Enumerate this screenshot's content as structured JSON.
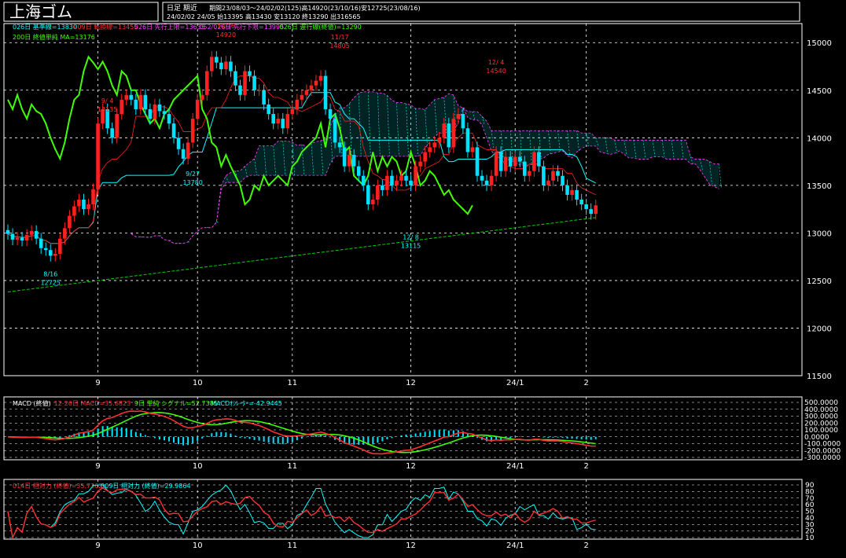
{
  "header": {
    "title": "上海ゴム",
    "period_type": "日足 期近",
    "info_line1": "期間23/08/03～24/02/02(125)高14920(23/10/16)安12725(23/08/16)",
    "info_line2": "24/02/02 24/05 始13395 高13430 安13120 終13290 出316565"
  },
  "colors": {
    "up_candle": "#ff2020",
    "down_candle": "#00e0ff",
    "grid": "#ffffff",
    "cloud": "#ff40ff",
    "cloud_hatch": "#00ffff",
    "ma200": "#00d000",
    "lagging": "#40ff00",
    "base_line": "#00ffff",
    "conversion_line": "#ff2020"
  },
  "legend": {
    "line1": [
      {
        "text": "026日 基準線=13830",
        "color": "#00ffff"
      },
      {
        "text": "009日 転換線=13455",
        "color": "#ff3030"
      },
      {
        "text": "026日 先行上限=13635",
        "color": "#ff40ff"
      },
      {
        "text": "052/026日 先行下限=13995",
        "color": "#ff40ff"
      },
      {
        "text": "026日 遅行線(終値)=13290",
        "color": "#40ff00"
      }
    ],
    "line2": [
      {
        "text": "200日 終値単純 MA=13176",
        "color": "#40ff00"
      }
    ]
  },
  "macd_legend": [
    {
      "text": "MACD (終値)",
      "color": "#ffffff"
    },
    {
      "text": "12-26日 MACD=35.6823",
      "color": "#ff3030"
    },
    {
      "text": "9日 単純 シグナル=52.7385",
      "color": "#40ff00"
    },
    {
      "text": "MACDｵｼﾚｰﾀｰ=-42.9445",
      "color": "#00ffff"
    }
  ],
  "rsi_legend": [
    {
      "text": "014日 相対力 (終値)=35.7362",
      "color": "#ff3030"
    },
    {
      "text": "009日 相対力 (終値)=29.9864",
      "color": "#00ffff"
    }
  ],
  "chart_data": {
    "type": "candlestick",
    "dates": [
      "23/08/03",
      "23/08/04",
      "23/08/07",
      "23/08/08",
      "23/08/09",
      "23/08/10",
      "23/08/11",
      "23/08/14",
      "23/08/15",
      "23/08/16",
      "23/08/17",
      "23/08/18",
      "23/08/21",
      "23/08/22",
      "23/08/23",
      "23/08/24",
      "23/08/25",
      "23/08/28",
      "23/08/29",
      "23/08/30",
      "23/08/31",
      "23/09/01",
      "23/09/04",
      "23/09/05",
      "23/09/06",
      "23/09/07",
      "23/09/08",
      "23/09/11",
      "23/09/12",
      "23/09/13",
      "23/09/14",
      "23/09/15",
      "23/09/18",
      "23/09/19",
      "23/09/20",
      "23/09/21",
      "23/09/22",
      "23/09/25",
      "23/09/26",
      "23/09/27",
      "23/09/28",
      "23/10/09",
      "23/10/10",
      "23/10/11",
      "23/10/12",
      "23/10/13",
      "23/10/16",
      "23/10/17",
      "23/10/18",
      "23/10/19",
      "23/10/20",
      "23/10/23",
      "23/10/24",
      "23/10/25",
      "23/10/26",
      "23/10/27",
      "23/10/30",
      "23/10/31",
      "23/11/01",
      "23/11/02",
      "23/11/03",
      "23/11/06",
      "23/11/07",
      "23/11/08",
      "23/11/09",
      "23/11/10",
      "23/11/13",
      "23/11/14",
      "23/11/15",
      "23/11/16",
      "23/11/17",
      "23/11/20",
      "23/11/21",
      "23/11/22",
      "23/11/23",
      "23/11/24",
      "23/11/27",
      "23/11/28",
      "23/11/29",
      "23/11/30",
      "23/12/01",
      "23/12/04",
      "23/12/05",
      "23/12/06",
      "23/12/07",
      "23/12/08",
      "23/12/11",
      "23/12/12",
      "23/12/13",
      "23/12/14",
      "23/12/15",
      "23/12/18",
      "23/12/19",
      "23/12/20",
      "23/12/21",
      "23/12/22",
      "23/12/25",
      "23/12/26",
      "23/12/27",
      "23/12/28",
      "23/12/29",
      "24/01/02",
      "24/01/03",
      "24/01/04",
      "24/01/05",
      "24/01/08",
      "24/01/09",
      "24/01/10",
      "24/01/11",
      "24/01/12",
      "24/01/15",
      "24/01/16",
      "24/01/17",
      "24/01/18",
      "24/01/19",
      "24/01/22",
      "24/01/23",
      "24/01/24",
      "24/01/25",
      "24/01/26",
      "24/01/29",
      "24/01/30",
      "24/01/31",
      "24/02/01",
      "24/02/02"
    ],
    "close": [
      12990,
      12930,
      12950,
      12920,
      12980,
      13020,
      12940,
      12840,
      12820,
      12760,
      12780,
      12940,
      13050,
      13180,
      13280,
      13350,
      13250,
      13300,
      13460,
      14150,
      14300,
      14100,
      14000,
      14250,
      14400,
      14450,
      14400,
      14300,
      14450,
      14300,
      14200,
      14350,
      14280,
      14250,
      14150,
      14000,
      13880,
      13780,
      13950,
      14200,
      14400,
      14450,
      14700,
      14850,
      14790,
      14720,
      14800,
      14700,
      14550,
      14450,
      14700,
      14650,
      14500,
      14500,
      14350,
      14250,
      14150,
      14200,
      14100,
      14250,
      14300,
      14400,
      14450,
      14500,
      14550,
      14600,
      14650,
      14300,
      14200,
      13950,
      13900,
      13700,
      13820,
      13700,
      13600,
      13500,
      13300,
      13350,
      13500,
      13450,
      13600,
      13500,
      13550,
      13600,
      13550,
      13500,
      13700,
      13750,
      13850,
      13900,
      13950,
      14000,
      14150,
      13900,
      14200,
      14250,
      14100,
      13850,
      13900,
      13600,
      13550,
      13500,
      13600,
      13850,
      13650,
      13800,
      13700,
      13800,
      13750,
      13600,
      13650,
      13850,
      13700,
      13500,
      13550,
      13650,
      13600,
      13500,
      13400,
      13450,
      13350,
      13300,
      13250,
      13200,
      13290
    ],
    "ylim": [
      11500,
      15200
    ],
    "price_ticks": [
      11500,
      12000,
      12500,
      13000,
      13500,
      14000,
      14500,
      15000
    ],
    "month_labels": [
      {
        "label": "9",
        "index": 19
      },
      {
        "label": "10",
        "index": 40
      },
      {
        "label": "11",
        "index": 60
      },
      {
        "label": "12",
        "index": 85
      },
      {
        "label": "24/1",
        "index": 107
      },
      {
        "label": "2",
        "index": 122
      }
    ],
    "annotations": [
      {
        "date": "9/ 4",
        "value": "14135",
        "index": 21,
        "pos": "top"
      },
      {
        "date": "10/16",
        "value": "14920",
        "index": 46,
        "pos": "top"
      },
      {
        "date": "11/17",
        "value": "14805",
        "index": 70,
        "pos": "top"
      },
      {
        "date": "12/ 4",
        "value": "14540",
        "index": 103,
        "pos": "top"
      },
      {
        "date": "8/16",
        "value": "12725",
        "index": 9,
        "pos": "bottom"
      },
      {
        "date": "9/27",
        "value": "13780",
        "index": 39,
        "pos": "bottom"
      },
      {
        "date": "12/ 8",
        "value": "13115",
        "index": 85,
        "pos": "bottom"
      }
    ],
    "macd_ticks": [
      "500.0000",
      "400.0000",
      "300.0000",
      "200.0000",
      "100.0000",
      "0.0000",
      "-100.0000",
      "-200.0000",
      "-300.0000"
    ],
    "macd_ylim": [
      -300,
      500
    ],
    "rsi_ticks": [
      "90",
      "80",
      "70",
      "60",
      "50",
      "40",
      "30",
      "20",
      "10"
    ],
    "rsi_ylim": [
      10,
      90
    ]
  }
}
